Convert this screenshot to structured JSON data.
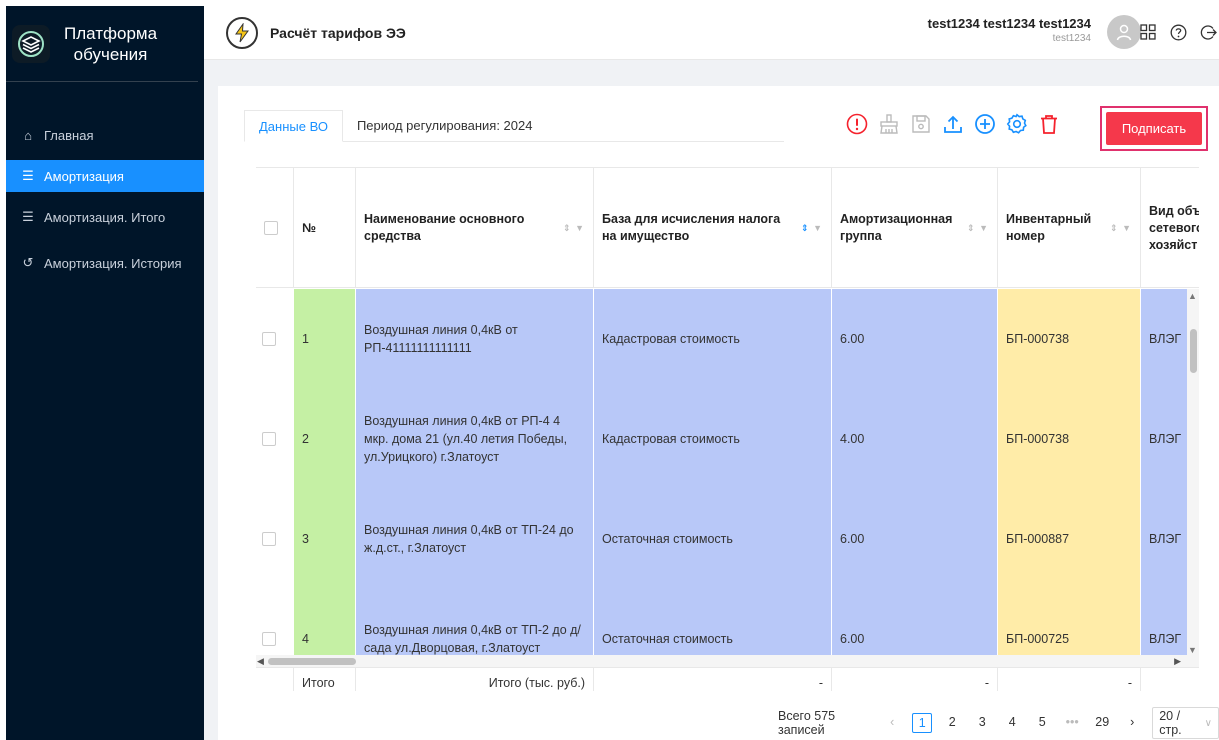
{
  "brand": {
    "title_line1": "Платформа",
    "title_line2": "обучения"
  },
  "sidebar": {
    "items": [
      {
        "label": "Главная",
        "icon": "home-icon"
      },
      {
        "label": "Амортизация",
        "icon": "list-icon",
        "active": true
      },
      {
        "label": "Амортизация. Итого",
        "icon": "list-icon"
      },
      {
        "label": "Амортизация. История",
        "icon": "history-icon"
      }
    ]
  },
  "header": {
    "app_title": "Расчёт тарифов ЭЭ",
    "user_name": "test1234 test1234 test1234",
    "user_login": "test1234"
  },
  "tabs": [
    {
      "label": "Данные ВО",
      "active": true
    },
    {
      "label": "Период регулирования: 2024"
    }
  ],
  "toolbar": {
    "sign_label": "Подписать"
  },
  "table": {
    "columns": {
      "no": "№",
      "name": "Наименование основного средства",
      "base": "База для исчисления налога на имущество",
      "group": "Амортизационная группа",
      "inv": "Инвентарный номер",
      "kind": "Вид объ сетевого хозяйст"
    },
    "rows": [
      {
        "no": "1",
        "name": "Воздушная линия 0,4кВ от РП-41111111111111",
        "base": "Кадастровая стоимость",
        "group": "6.00",
        "inv": "БП-000738",
        "kind": "ВЛЭГ"
      },
      {
        "no": "2",
        "name": "Воздушная линия 0,4кВ от РП-4 4 мкр. дома 21 (ул.40 летия Победы, ул.Урицкого) г.Златоуст",
        "base": "Кадастровая стоимость",
        "group": "4.00",
        "inv": "БП-000738",
        "kind": "ВЛЭГ"
      },
      {
        "no": "3",
        "name": "Воздушная линия 0,4кВ от ТП-24 до ж.д.ст., г.Златоуст",
        "base": "Остаточная стоимость",
        "group": "6.00",
        "inv": "БП-000887",
        "kind": "ВЛЭГ"
      },
      {
        "no": "4",
        "name": "Воздушная линия 0,4кВ от ТП-2 до д/сада ул.Дворцовая, г.Златоуст",
        "base": "Остаточная стоимость",
        "group": "6.00",
        "inv": "БП-000725",
        "kind": "ВЛЭГ"
      }
    ],
    "summary": {
      "label": "Итого",
      "sub_label": "Итого (тыс. руб.)",
      "dash": "-"
    }
  },
  "pagination": {
    "total": "Всего 575 записей",
    "pages": [
      "1",
      "2",
      "3",
      "4",
      "5"
    ],
    "ellipsis": "•••",
    "last": "29",
    "page_size": "20 / стр."
  },
  "colors": {
    "accent": "#1890ff",
    "sidebar_bg": "#001529",
    "sign_btn": "#f5384b",
    "toolbar_icon": "#1890ff",
    "danger_icon": "#f5222d"
  }
}
